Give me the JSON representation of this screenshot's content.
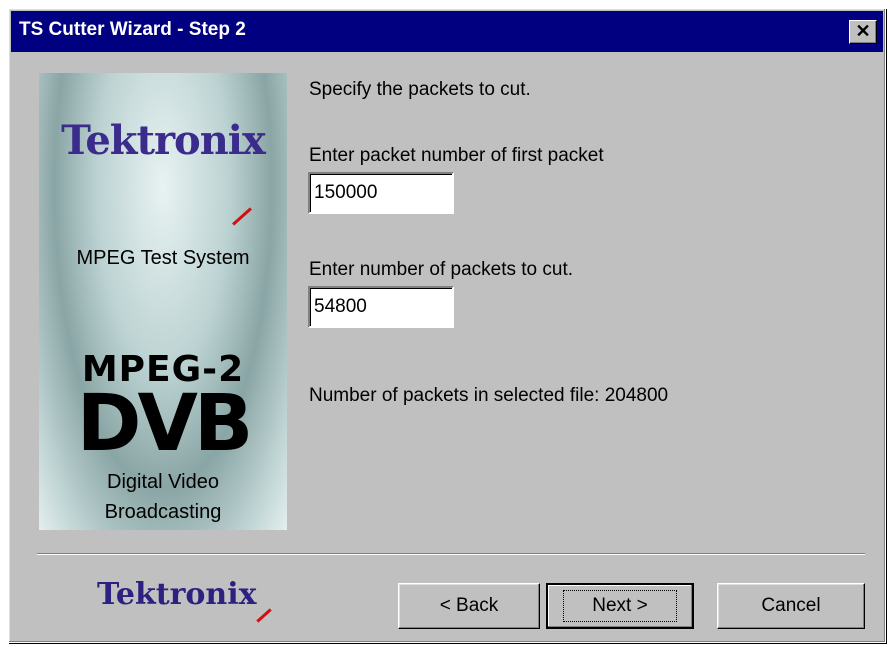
{
  "window": {
    "title": "TS Cutter Wizard - Step 2",
    "close_glyph": "✕"
  },
  "banner": {
    "brand": "Tektronix",
    "subtitle": "MPEG Test System",
    "mpeg_label": "MPEG-2",
    "dvb_logo": "DVB",
    "dvb_line1": "Digital Video",
    "dvb_line2": "Broadcasting"
  },
  "form": {
    "instruction": "Specify the packets to cut.",
    "first_packet_label": "Enter packet number of first packet",
    "first_packet_value": "150000",
    "count_label": "Enter number of packets to cut.",
    "count_value": "54800",
    "total_text": "Number of packets in selected file: 204800"
  },
  "footer": {
    "brand": "Tektronix",
    "back_label": "< Back",
    "next_label": "Next >",
    "cancel_label": "Cancel"
  },
  "colors": {
    "titlebar": "#000080",
    "dialog": "#c0c0c0",
    "brand": "#3a2b8c",
    "accent": "#d01010"
  }
}
